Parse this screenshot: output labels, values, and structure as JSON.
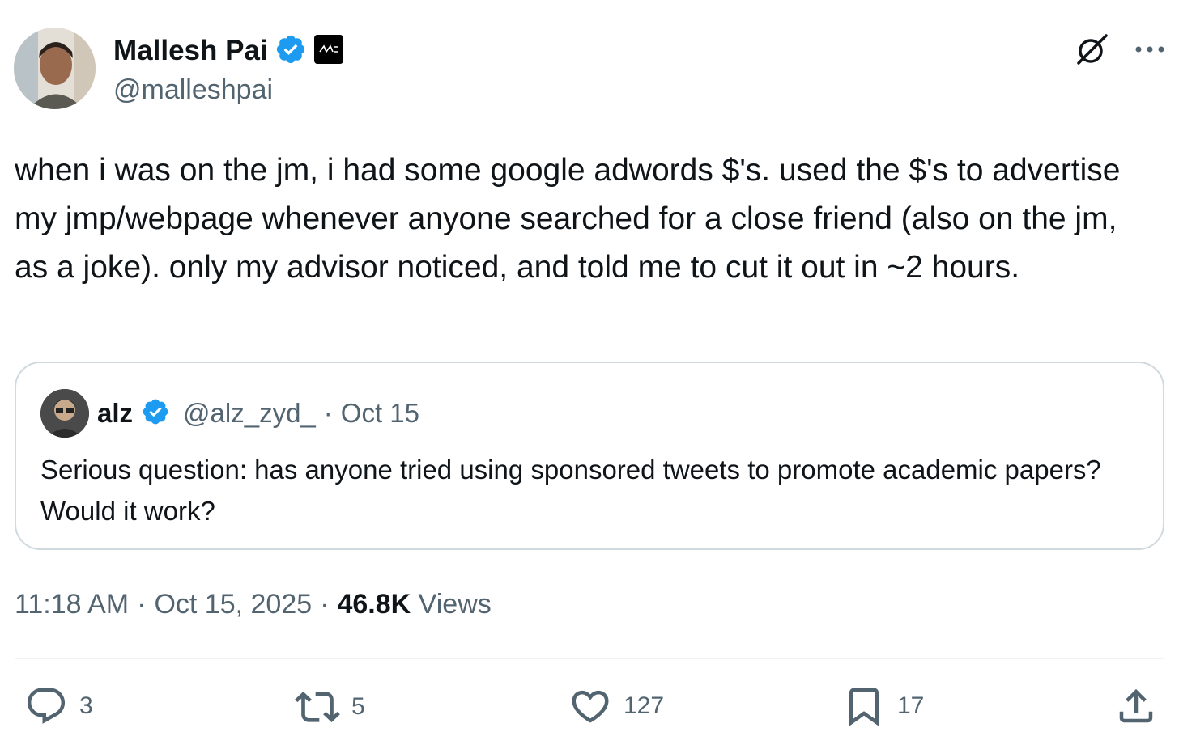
{
  "author": {
    "name": "Mallesh Pai",
    "handle": "@malleshpai",
    "verified": true,
    "affiliation_badge_icon": "affiliation-logo-icon"
  },
  "tweet": {
    "text": "when i was on the jm, i had some google adwords $'s. used the $'s to advertise my jmp/webpage whenever anyone searched for a close friend (also on the jm, as a joke). only my advisor noticed, and told me to cut it out in ~2 hours."
  },
  "quoted": {
    "name": "alz",
    "handle": "@alz_zyd_",
    "date": "Oct 15",
    "text": "Serious question: has anyone tried using sponsored tweets to promote academic papers? Would it work?"
  },
  "meta": {
    "time": "11:18 AM",
    "date": "Oct 15, 2025",
    "views_count": "46.8K",
    "views_label": "Views"
  },
  "actions": {
    "replies": "3",
    "reposts": "5",
    "likes": "127",
    "bookmarks": "17"
  },
  "colors": {
    "text": "#0f1419",
    "secondary": "#536471",
    "verified": "#1d9bf0",
    "border": "#cfd9de"
  }
}
